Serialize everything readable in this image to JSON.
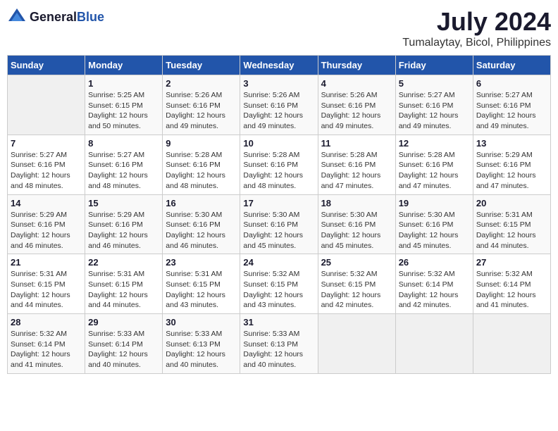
{
  "logo": {
    "general": "General",
    "blue": "Blue"
  },
  "title": "July 2024",
  "location": "Tumalaytay, Bicol, Philippines",
  "days_of_week": [
    "Sunday",
    "Monday",
    "Tuesday",
    "Wednesday",
    "Thursday",
    "Friday",
    "Saturday"
  ],
  "weeks": [
    [
      {
        "day": "",
        "detail": ""
      },
      {
        "day": "1",
        "detail": "Sunrise: 5:25 AM\nSunset: 6:15 PM\nDaylight: 12 hours\nand 50 minutes."
      },
      {
        "day": "2",
        "detail": "Sunrise: 5:26 AM\nSunset: 6:16 PM\nDaylight: 12 hours\nand 49 minutes."
      },
      {
        "day": "3",
        "detail": "Sunrise: 5:26 AM\nSunset: 6:16 PM\nDaylight: 12 hours\nand 49 minutes."
      },
      {
        "day": "4",
        "detail": "Sunrise: 5:26 AM\nSunset: 6:16 PM\nDaylight: 12 hours\nand 49 minutes."
      },
      {
        "day": "5",
        "detail": "Sunrise: 5:27 AM\nSunset: 6:16 PM\nDaylight: 12 hours\nand 49 minutes."
      },
      {
        "day": "6",
        "detail": "Sunrise: 5:27 AM\nSunset: 6:16 PM\nDaylight: 12 hours\nand 49 minutes."
      }
    ],
    [
      {
        "day": "7",
        "detail": "Sunrise: 5:27 AM\nSunset: 6:16 PM\nDaylight: 12 hours\nand 48 minutes."
      },
      {
        "day": "8",
        "detail": "Sunrise: 5:27 AM\nSunset: 6:16 PM\nDaylight: 12 hours\nand 48 minutes."
      },
      {
        "day": "9",
        "detail": "Sunrise: 5:28 AM\nSunset: 6:16 PM\nDaylight: 12 hours\nand 48 minutes."
      },
      {
        "day": "10",
        "detail": "Sunrise: 5:28 AM\nSunset: 6:16 PM\nDaylight: 12 hours\nand 48 minutes."
      },
      {
        "day": "11",
        "detail": "Sunrise: 5:28 AM\nSunset: 6:16 PM\nDaylight: 12 hours\nand 47 minutes."
      },
      {
        "day": "12",
        "detail": "Sunrise: 5:28 AM\nSunset: 6:16 PM\nDaylight: 12 hours\nand 47 minutes."
      },
      {
        "day": "13",
        "detail": "Sunrise: 5:29 AM\nSunset: 6:16 PM\nDaylight: 12 hours\nand 47 minutes."
      }
    ],
    [
      {
        "day": "14",
        "detail": "Sunrise: 5:29 AM\nSunset: 6:16 PM\nDaylight: 12 hours\nand 46 minutes."
      },
      {
        "day": "15",
        "detail": "Sunrise: 5:29 AM\nSunset: 6:16 PM\nDaylight: 12 hours\nand 46 minutes."
      },
      {
        "day": "16",
        "detail": "Sunrise: 5:30 AM\nSunset: 6:16 PM\nDaylight: 12 hours\nand 46 minutes."
      },
      {
        "day": "17",
        "detail": "Sunrise: 5:30 AM\nSunset: 6:16 PM\nDaylight: 12 hours\nand 45 minutes."
      },
      {
        "day": "18",
        "detail": "Sunrise: 5:30 AM\nSunset: 6:16 PM\nDaylight: 12 hours\nand 45 minutes."
      },
      {
        "day": "19",
        "detail": "Sunrise: 5:30 AM\nSunset: 6:16 PM\nDaylight: 12 hours\nand 45 minutes."
      },
      {
        "day": "20",
        "detail": "Sunrise: 5:31 AM\nSunset: 6:15 PM\nDaylight: 12 hours\nand 44 minutes."
      }
    ],
    [
      {
        "day": "21",
        "detail": "Sunrise: 5:31 AM\nSunset: 6:15 PM\nDaylight: 12 hours\nand 44 minutes."
      },
      {
        "day": "22",
        "detail": "Sunrise: 5:31 AM\nSunset: 6:15 PM\nDaylight: 12 hours\nand 44 minutes."
      },
      {
        "day": "23",
        "detail": "Sunrise: 5:31 AM\nSunset: 6:15 PM\nDaylight: 12 hours\nand 43 minutes."
      },
      {
        "day": "24",
        "detail": "Sunrise: 5:32 AM\nSunset: 6:15 PM\nDaylight: 12 hours\nand 43 minutes."
      },
      {
        "day": "25",
        "detail": "Sunrise: 5:32 AM\nSunset: 6:15 PM\nDaylight: 12 hours\nand 42 minutes."
      },
      {
        "day": "26",
        "detail": "Sunrise: 5:32 AM\nSunset: 6:14 PM\nDaylight: 12 hours\nand 42 minutes."
      },
      {
        "day": "27",
        "detail": "Sunrise: 5:32 AM\nSunset: 6:14 PM\nDaylight: 12 hours\nand 41 minutes."
      }
    ],
    [
      {
        "day": "28",
        "detail": "Sunrise: 5:32 AM\nSunset: 6:14 PM\nDaylight: 12 hours\nand 41 minutes."
      },
      {
        "day": "29",
        "detail": "Sunrise: 5:33 AM\nSunset: 6:14 PM\nDaylight: 12 hours\nand 40 minutes."
      },
      {
        "day": "30",
        "detail": "Sunrise: 5:33 AM\nSunset: 6:13 PM\nDaylight: 12 hours\nand 40 minutes."
      },
      {
        "day": "31",
        "detail": "Sunrise: 5:33 AM\nSunset: 6:13 PM\nDaylight: 12 hours\nand 40 minutes."
      },
      {
        "day": "",
        "detail": ""
      },
      {
        "day": "",
        "detail": ""
      },
      {
        "day": "",
        "detail": ""
      }
    ]
  ]
}
